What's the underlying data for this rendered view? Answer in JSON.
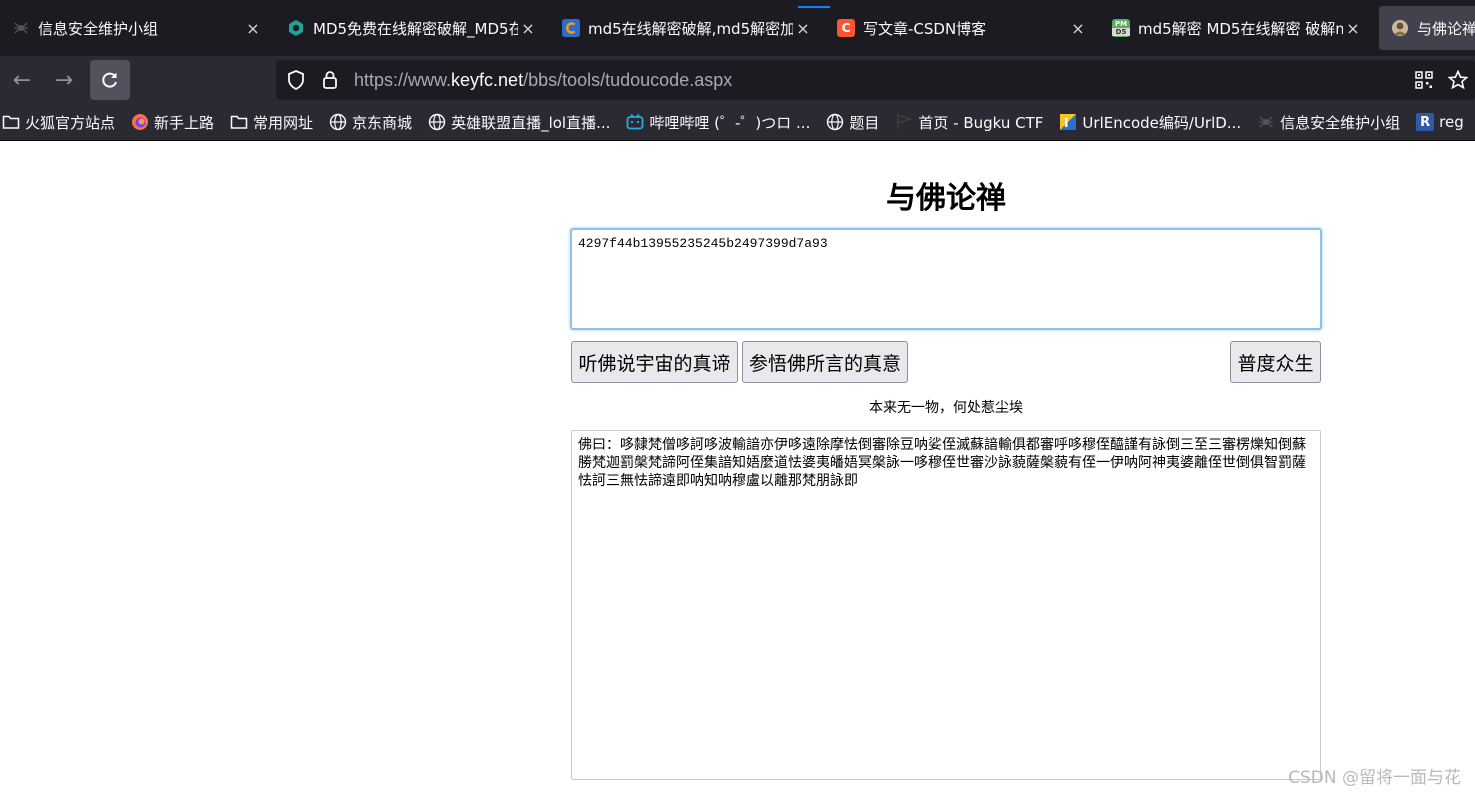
{
  "tabs": [
    {
      "title": "信息安全维护小组",
      "icon": "spider-icon",
      "close": "×"
    },
    {
      "title": "MD5免费在线解密破解_MD5在",
      "icon": "cmd5-icon",
      "close": "×"
    },
    {
      "title": "md5在线解密破解,md5解密加",
      "icon": "c-logo-icon",
      "close": "×"
    },
    {
      "title": "写文章-CSDN博客",
      "icon": "csdn-icon",
      "close": "×"
    },
    {
      "title": "md5解密 MD5在线解密 破解m",
      "icon": "pmd5-icon",
      "close": "×"
    },
    {
      "title": "与佛论禅",
      "icon": "buddha-icon"
    }
  ],
  "nav": {
    "back": "←",
    "forward": "→",
    "reload": "↻",
    "url_prefix": "https://www.",
    "url_host": "keyfc.net",
    "url_path": "/bbs/tools/tudoucode.aspx"
  },
  "bookmarks": [
    {
      "label": "火狐官方站点",
      "icon": "folder-icon"
    },
    {
      "label": "新手上路",
      "icon": "firefox-icon"
    },
    {
      "label": "常用网址",
      "icon": "folder-icon"
    },
    {
      "label": "京东商城",
      "icon": "globe-icon"
    },
    {
      "label": "英雄联盟直播_lol直播...",
      "icon": "globe-icon"
    },
    {
      "label": "哔哩哔哩 (゜-゜)つロ ...",
      "icon": "bilibili-icon"
    },
    {
      "label": "题目",
      "icon": "globe-icon"
    },
    {
      "label": "首页 - Bugku CTF",
      "icon": "bugku-icon"
    },
    {
      "label": "UrlEncode编码/UrlD...",
      "icon": "urlencode-icon"
    },
    {
      "label": "信息安全维护小组",
      "icon": "spider-icon"
    },
    {
      "label": "reg",
      "icon": "r-icon"
    }
  ],
  "page": {
    "title": "与佛论禅",
    "input_value": "4297f44b13955235245b2497399d7a93",
    "decode_button": "听佛说宇宙的真谛",
    "encode_button": "参悟佛所言的真意",
    "clear_button": "普度众生",
    "motto": "本来无一物，何处惹尘埃",
    "output_value": "佛曰：哆隸梵僧哆訶哆波輸諳亦伊哆遠除摩怯倒審除豆呐娑侄滅蘇諳輸俱都審呼哆穆侄醯謹有詠倒三至三審楞爍知倒蘇勝梵迦罰槃梵諦阿侄集諳知娪麼道怯婆夷皤娪冥槃詠一哆穆侄世審沙詠藐薩槃藐有侄一伊呐阿神夷婆離侄世倒俱智罰薩怯訶三無怯諦遠即呐知呐穆盧以離那梵朋詠即"
  },
  "watermark": "CSDN @留将一面与花"
}
